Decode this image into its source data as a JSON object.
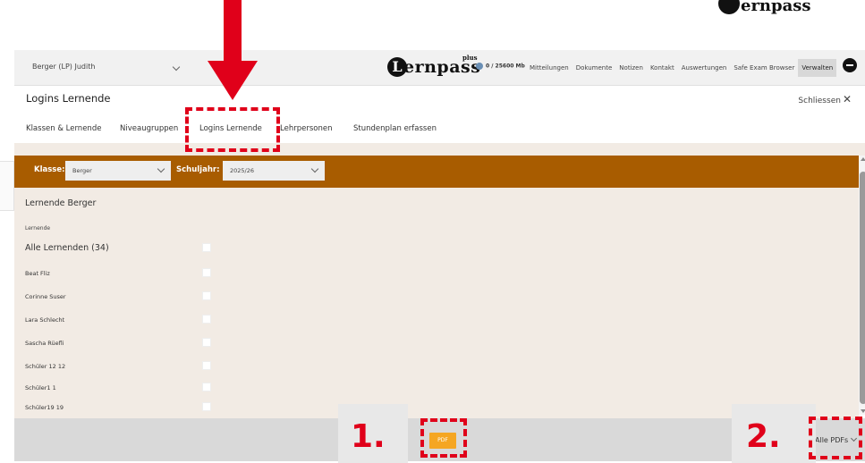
{
  "app": {
    "user_select": "Berger (LP) Judith",
    "brand": {
      "initial": "L",
      "text": "ernpass",
      "superscript": "plus"
    },
    "storage": "0 / 25600 Mb",
    "nav": [
      "Mitteilungen",
      "Dokumente",
      "Notizen",
      "Kontakt",
      "Auswertungen",
      "Safe Exam Browser",
      "Verwalten"
    ],
    "active_nav": "Verwalten"
  },
  "page": {
    "title": "Logins Lernende",
    "close_label": "Schliessen"
  },
  "tabs": [
    "Klassen & Lernende",
    "Niveaugruppen",
    "Logins Lernende",
    "Lehrpersonen",
    "Stundenplan erfassen"
  ],
  "filters": {
    "klasse_label": "Klasse:",
    "klasse_value": "Berger",
    "schuljahr_label": "Schuljahr:",
    "schuljahr_value": "2025/26"
  },
  "panel": {
    "heading": "Lernende Berger",
    "column_header": "Lernende",
    "all_label": "Alle Lernenden (34)",
    "students": [
      "Beat Fliz",
      "Corinne Suser",
      "Lara Schlecht",
      "Sascha Rüefli",
      "Schüler 12 12",
      "Schüler1 1",
      "Schüler19 19"
    ]
  },
  "footer": {
    "pdf_button": "PDF",
    "alle_pdfs": "Alle PDFs"
  },
  "annotations": {
    "step1": "1.",
    "step2": "2.",
    "color": "#e0001a"
  },
  "colors": {
    "filter_bar": "#a85c00",
    "pdf_button": "#f5a623",
    "content_bg": "#f2ebe4"
  }
}
